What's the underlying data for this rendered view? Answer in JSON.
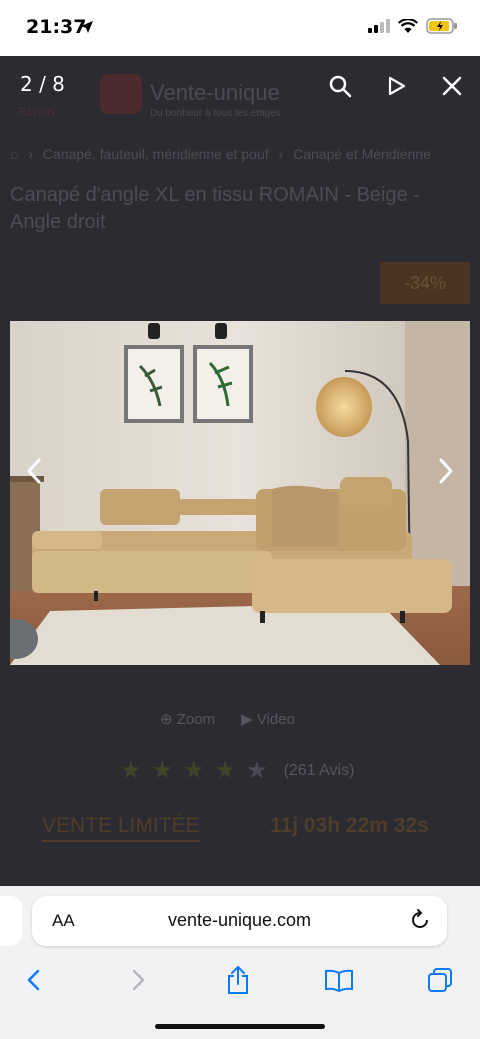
{
  "status_bar": {
    "time": "21:37"
  },
  "viewer": {
    "counter": "2 / 8"
  },
  "site": {
    "name": "Vente-unique",
    "tagline": "Du bonheur à tous les étages",
    "menu_label": "Rayons"
  },
  "breadcrumb": {
    "items": [
      "Canapé, fauteuil, méridienne et pouf",
      "Canapé et Méridienne"
    ]
  },
  "product": {
    "title": "Canapé d'angle XL en tissu ROMAIN - Beige - Angle droit",
    "discount": "-34%",
    "zoom_label": "Zoom",
    "video_label": "Video",
    "rating": 4,
    "reviews": "(261 Avis)",
    "sale_label": "VENTE LIMITÉE",
    "countdown": "11j 03h 22m 32s"
  },
  "browser": {
    "text_size_label": "AA",
    "domain": "vente-unique.com"
  },
  "icons": {
    "search": "search-icon",
    "slideshow": "play-icon",
    "close": "close-icon",
    "prev": "chevron-left-icon",
    "next": "chevron-right-icon",
    "reload": "reload-icon",
    "back": "back-icon",
    "forward": "forward-icon",
    "share": "share-icon",
    "bookmarks": "book-icon",
    "tabs": "tabs-icon"
  },
  "colors": {
    "ios_blue": "#0a7aff",
    "brand": "#c8343b"
  }
}
